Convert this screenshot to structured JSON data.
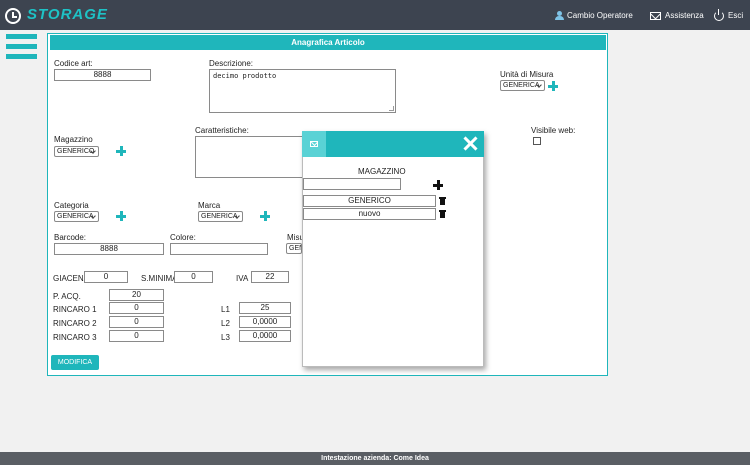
{
  "app": {
    "name": "STORAGE",
    "nav": {
      "cambio_operatore": "Cambio Operatore",
      "assistenza": "Assistenza",
      "esci": "Esci"
    }
  },
  "panel": {
    "title": "Anagrafica Articolo",
    "codice_art": {
      "label": "Codice art:",
      "value": "8888"
    },
    "descrizione": {
      "label": "Descrizione:",
      "value": "decimo prodotto"
    },
    "unita_misura": {
      "label": "Unità di Misura",
      "value": "GENERICA"
    },
    "magazzino": {
      "label": "Magazzino",
      "value": "GENERICO"
    },
    "caratteristiche": {
      "label": "Caratteristiche:",
      "value": ""
    },
    "visibile_web": {
      "label": "Visibile web:",
      "checked": false
    },
    "categoria": {
      "label": "Categoria",
      "value": "GENERICA"
    },
    "marca": {
      "label": "Marca",
      "value": "GENERICA"
    },
    "barcode": {
      "label": "Barcode:",
      "value": "8888"
    },
    "colore": {
      "label": "Colore:",
      "value": ""
    },
    "misura": {
      "label": "Misu",
      "value": "GEN"
    },
    "giacenza": {
      "label": "GIACENZA",
      "value": "0"
    },
    "s_minima": {
      "label": "S.MINIMA",
      "value": "0"
    },
    "iva": {
      "label": "IVA",
      "value": "22"
    },
    "p_acq": {
      "label": "P. ACQ.",
      "value": "20"
    },
    "rincaro_1": {
      "label": "RINCARO 1",
      "value": "0"
    },
    "rincaro_2": {
      "label": "RINCARO 2",
      "value": "0"
    },
    "rincaro_3": {
      "label": "RINCARO 3",
      "value": "0"
    },
    "l1": {
      "label": "L1",
      "value": "25"
    },
    "l2": {
      "label": "L2",
      "value": "0,0000"
    },
    "l3": {
      "label": "L3",
      "value": "0,0000"
    },
    "modifica_label": "MODIFICA"
  },
  "modal": {
    "title": "MAGAZZINO",
    "new_value": "",
    "items": [
      "GENERICO",
      "nuovo"
    ]
  },
  "footer": {
    "text": "Intestazione azienda: Come Idea"
  },
  "colors": {
    "accent": "#1fb6bb",
    "topbar": "#3d4450",
    "footer": "#5a5e64"
  }
}
